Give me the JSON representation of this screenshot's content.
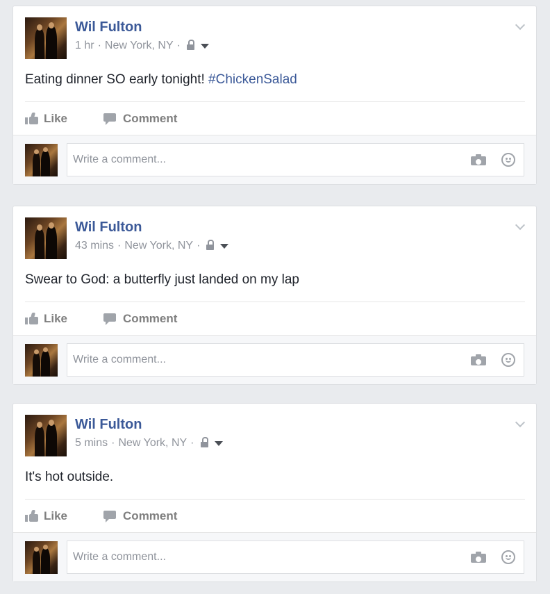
{
  "posts": [
    {
      "author": "Wil Fulton",
      "time": "1 hr",
      "location": "New York, NY",
      "text": "Eating dinner SO early tonight! ",
      "hashtag": "#ChickenSalad",
      "like_label": "Like",
      "comment_label": "Comment",
      "comment_placeholder": "Write a comment..."
    },
    {
      "author": "Wil Fulton",
      "time": "43 mins",
      "location": "New York, NY",
      "text": "Swear to God: a butterfly just landed on my lap",
      "hashtag": "",
      "like_label": "Like",
      "comment_label": "Comment",
      "comment_placeholder": "Write a comment..."
    },
    {
      "author": "Wil Fulton",
      "time": "5 mins",
      "location": "New York, NY",
      "text": "It's hot outside.",
      "hashtag": "",
      "like_label": "Like",
      "comment_label": "Comment",
      "comment_placeholder": "Write a comment..."
    }
  ],
  "separator": "·",
  "colors": {
    "author_link": "#3b5998",
    "background": "#e9ebee",
    "meta_text": "#90949c"
  },
  "icons": {
    "privacy": "lock-icon",
    "audience": "caret-icon",
    "options": "chevron-down-icon",
    "like": "thumbs-up-icon",
    "comment": "comment-bubble-icon",
    "photo": "camera-icon",
    "emoji": "smiley-icon"
  }
}
